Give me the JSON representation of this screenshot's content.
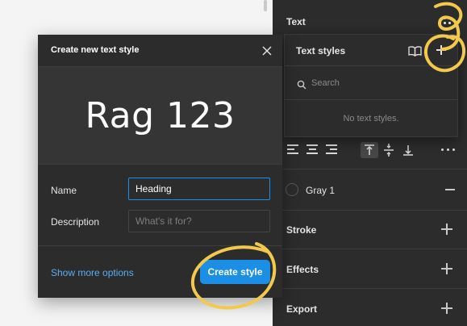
{
  "panel": {
    "text_section": {
      "label": "Text",
      "options_icon": "four-dots-icon"
    },
    "alignment": {
      "horizontal": [
        "align-left-icon",
        "align-center-icon",
        "align-right-icon"
      ],
      "vertical": [
        "align-top-icon",
        "align-middle-icon",
        "align-bottom-icon"
      ],
      "active_vertical": "align-top-icon",
      "more_icon": "more-dots-icon"
    },
    "fill": {
      "color_name": "Gray 1",
      "swatch_color": "#2c2c2c",
      "remove_icon": "minus-icon"
    },
    "sections": [
      {
        "label": "Stroke",
        "add_icon": "plus-icon"
      },
      {
        "label": "Effects",
        "add_icon": "plus-icon"
      },
      {
        "label": "Export",
        "add_icon": "plus-icon"
      }
    ]
  },
  "text_styles_popover": {
    "title": "Text styles",
    "library_icon": "book-icon",
    "add_icon": "plus-icon",
    "search": {
      "placeholder": "Search",
      "icon": "search-icon"
    },
    "empty_message": "No text styles."
  },
  "modal": {
    "title": "Create new text style",
    "close_icon": "close-icon",
    "preview_text": "Rag 123",
    "name": {
      "label": "Name",
      "value": "Heading"
    },
    "description": {
      "label": "Description",
      "placeholder": "What's it for?"
    },
    "show_more_label": "Show more options",
    "submit_label": "Create style"
  },
  "colors": {
    "panel_bg": "#2c2c2c",
    "canvas_bg": "#f4f4f4",
    "accent_blue": "#1b8fe6",
    "link_blue": "#5aaef0",
    "annotation_yellow": "#f2c94c"
  }
}
